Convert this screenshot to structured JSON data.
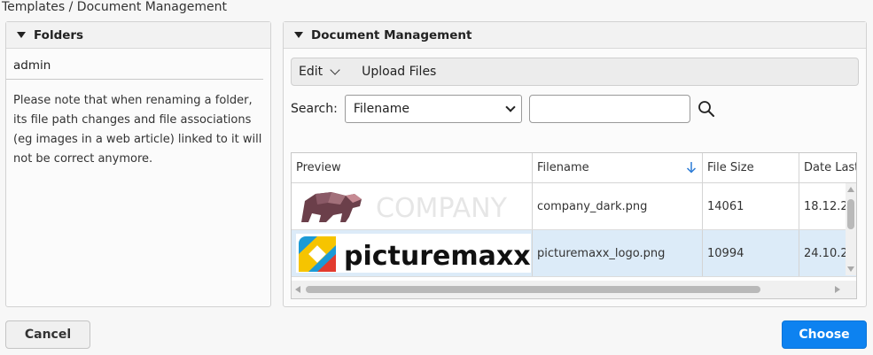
{
  "breadcrumb": "Templates / Document Management",
  "folders_panel": {
    "title": "Folders",
    "folder": "admin",
    "note": "Please note that when renaming a folder, its file path changes and file associations (eg images in a web article) linked to it will not be correct anymore."
  },
  "doc_panel": {
    "title": "Document Management",
    "toolbar": {
      "edit": "Edit",
      "upload": "Upload Files"
    },
    "search": {
      "label": "Search:",
      "field_selected": "Filename",
      "value": ""
    },
    "columns": [
      "Preview",
      "Filename",
      "File Size",
      "Date Last"
    ],
    "rows": [
      {
        "preview_text": "COMPANY",
        "filename": "company_dark.png",
        "size": "14061",
        "date": "18.12.2",
        "selected": false
      },
      {
        "preview_text": "picturemaxx",
        "filename": "picturemaxx_logo.png",
        "size": "10994",
        "date": "24.10.2",
        "selected": true
      }
    ]
  },
  "footer": {
    "cancel": "Cancel",
    "choose": "Choose"
  },
  "colors": {
    "accent": "#0d82f0",
    "selection": "#dcebf8"
  }
}
